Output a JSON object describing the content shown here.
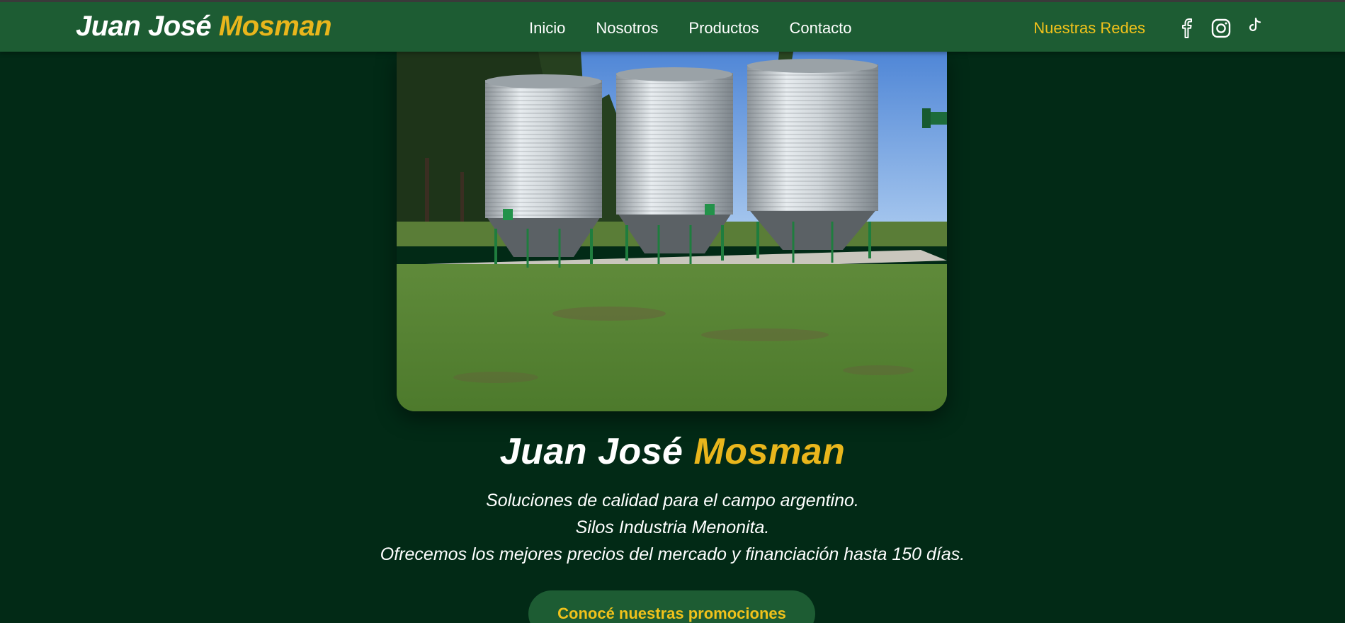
{
  "brand": {
    "first": "Juan José",
    "last": "Mosman"
  },
  "nav": {
    "links": [
      "Inicio",
      "Nosotros",
      "Productos",
      "Contacto"
    ]
  },
  "socials": {
    "label": "Nuestras Redes",
    "icons": [
      "facebook-icon",
      "instagram-icon",
      "tiktok-icon"
    ]
  },
  "hero": {
    "image": "grain-silos-photo",
    "title_first": "Juan José",
    "title_last": "Mosman",
    "lines": [
      "Soluciones de calidad para el campo argentino.",
      "Silos Industria Menonita.",
      "Ofrecemos los mejores precios del mercado y financiación hasta 150 días."
    ],
    "cta": "Conocé nuestras promociones"
  },
  "colors": {
    "background": "#022a16",
    "navbar": "#1d5c33",
    "accent": "#e9b61c",
    "accent_light": "#f1c21b",
    "text": "#ffffff"
  }
}
